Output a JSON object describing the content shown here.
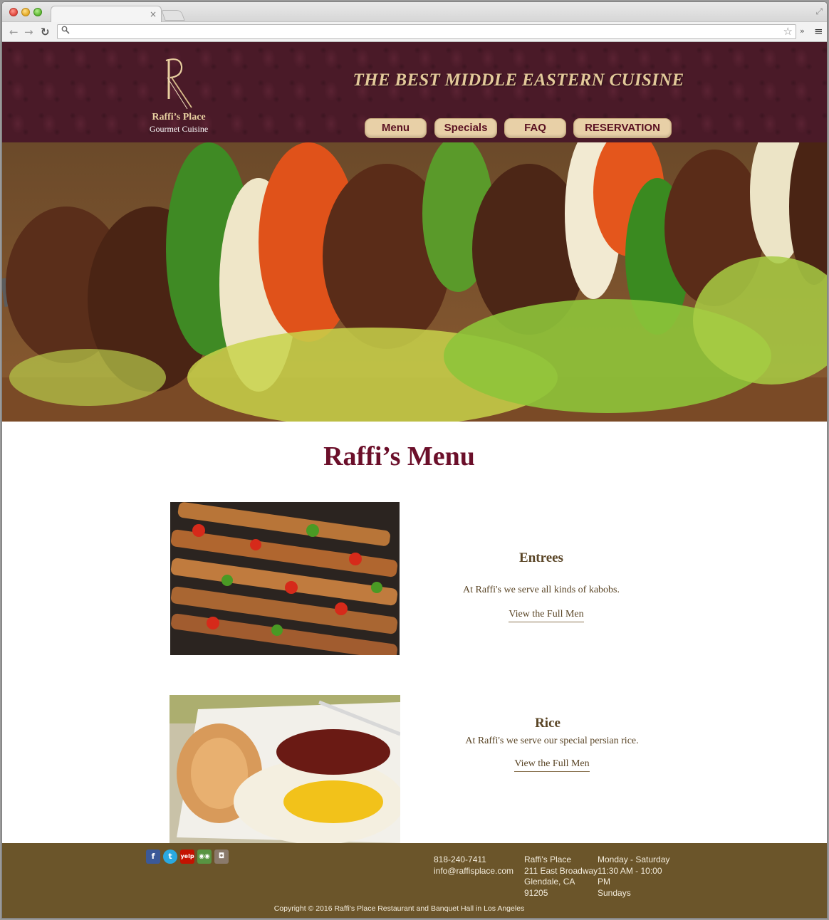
{
  "browser": {
    "tab_close": "×",
    "omnibox_value": "",
    "icons": {
      "back": "back-arrow-icon",
      "forward": "forward-arrow-icon",
      "reload": "reload-icon",
      "search": "search-icon",
      "star": "star-icon",
      "extensions": "extensions-chevron-icon",
      "menu": "hamburger-menu-icon"
    }
  },
  "header": {
    "logo_name": "Raffi’s Place",
    "logo_sub": "Gourmet Cuisine",
    "tagline": "THE BEST MIDDLE EASTERN CUISINE",
    "nav": [
      "Menu",
      "Specials",
      "FAQ",
      "RESERVATION"
    ]
  },
  "main": {
    "title": "Raffi’s Menu",
    "sections": [
      {
        "title": "Entrees",
        "description": "At Raffi's we serve all kinds of kabobs.",
        "link": "View the Full Men"
      },
      {
        "title": "Rice",
        "description": "At Raffi's we serve our special persian rice.",
        "link": "View the Full Men"
      }
    ]
  },
  "footer": {
    "social": [
      "facebook-icon",
      "twitter-icon",
      "yelp-icon",
      "tripadvisor-icon",
      "instagram-icon"
    ],
    "phone": "818-240-7411",
    "email": "info@raffisplace.com",
    "address": [
      "Raffi's Place",
      "211 East Broadway",
      "Glendale, CA",
      "91205"
    ],
    "hours": [
      "Monday - Saturday",
      "11:30 AM - 10:00",
      "PM",
      "Sundays"
    ],
    "copyright": "Copyright © 2016 Raffi's Place Restaurant and Banquet Hall in Los Angeles"
  },
  "colors": {
    "header_bg": "#4a1a28",
    "nav_button": "#e8d0a7",
    "title_color": "#6b0f2a",
    "text_brown": "#5a4526",
    "footer_bg": "#6b552a"
  }
}
